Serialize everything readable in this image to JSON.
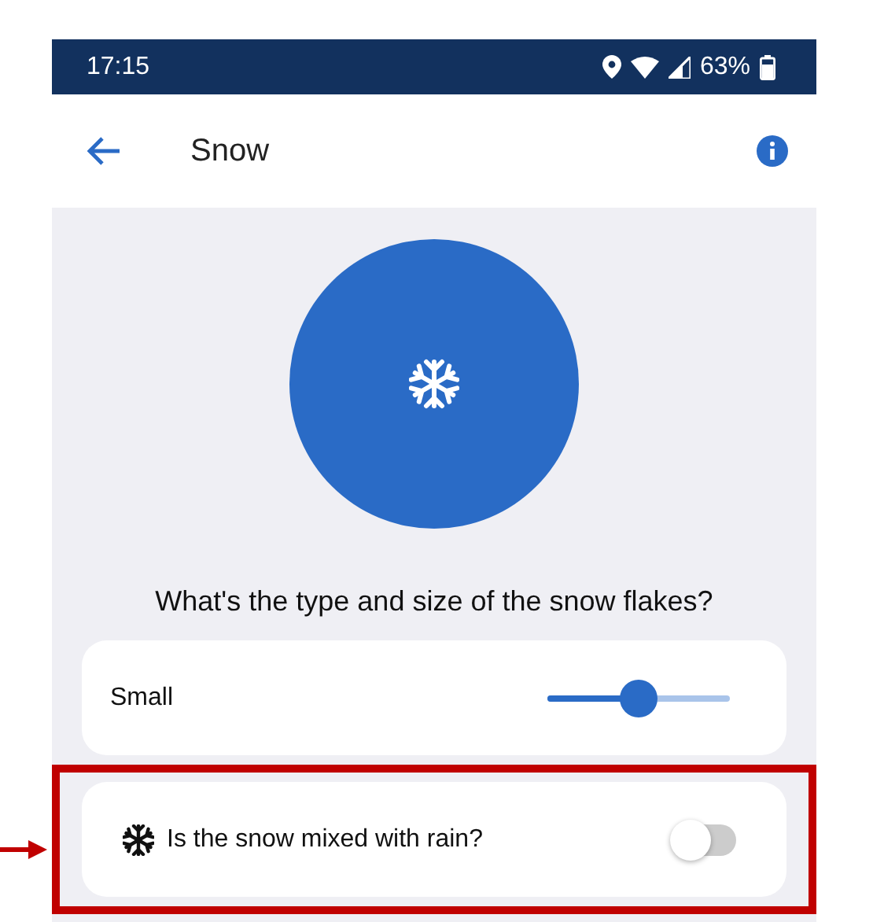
{
  "status_bar": {
    "time": "17:15",
    "battery": "63%"
  },
  "header": {
    "title": "Snow"
  },
  "question": "What's the type and size of the snow flakes?",
  "size_setting": {
    "label": "Small",
    "level": 0.5
  },
  "rain_setting": {
    "label": "Is the snow mixed with rain?",
    "on": false
  },
  "annotation": {
    "highlighted": true
  }
}
